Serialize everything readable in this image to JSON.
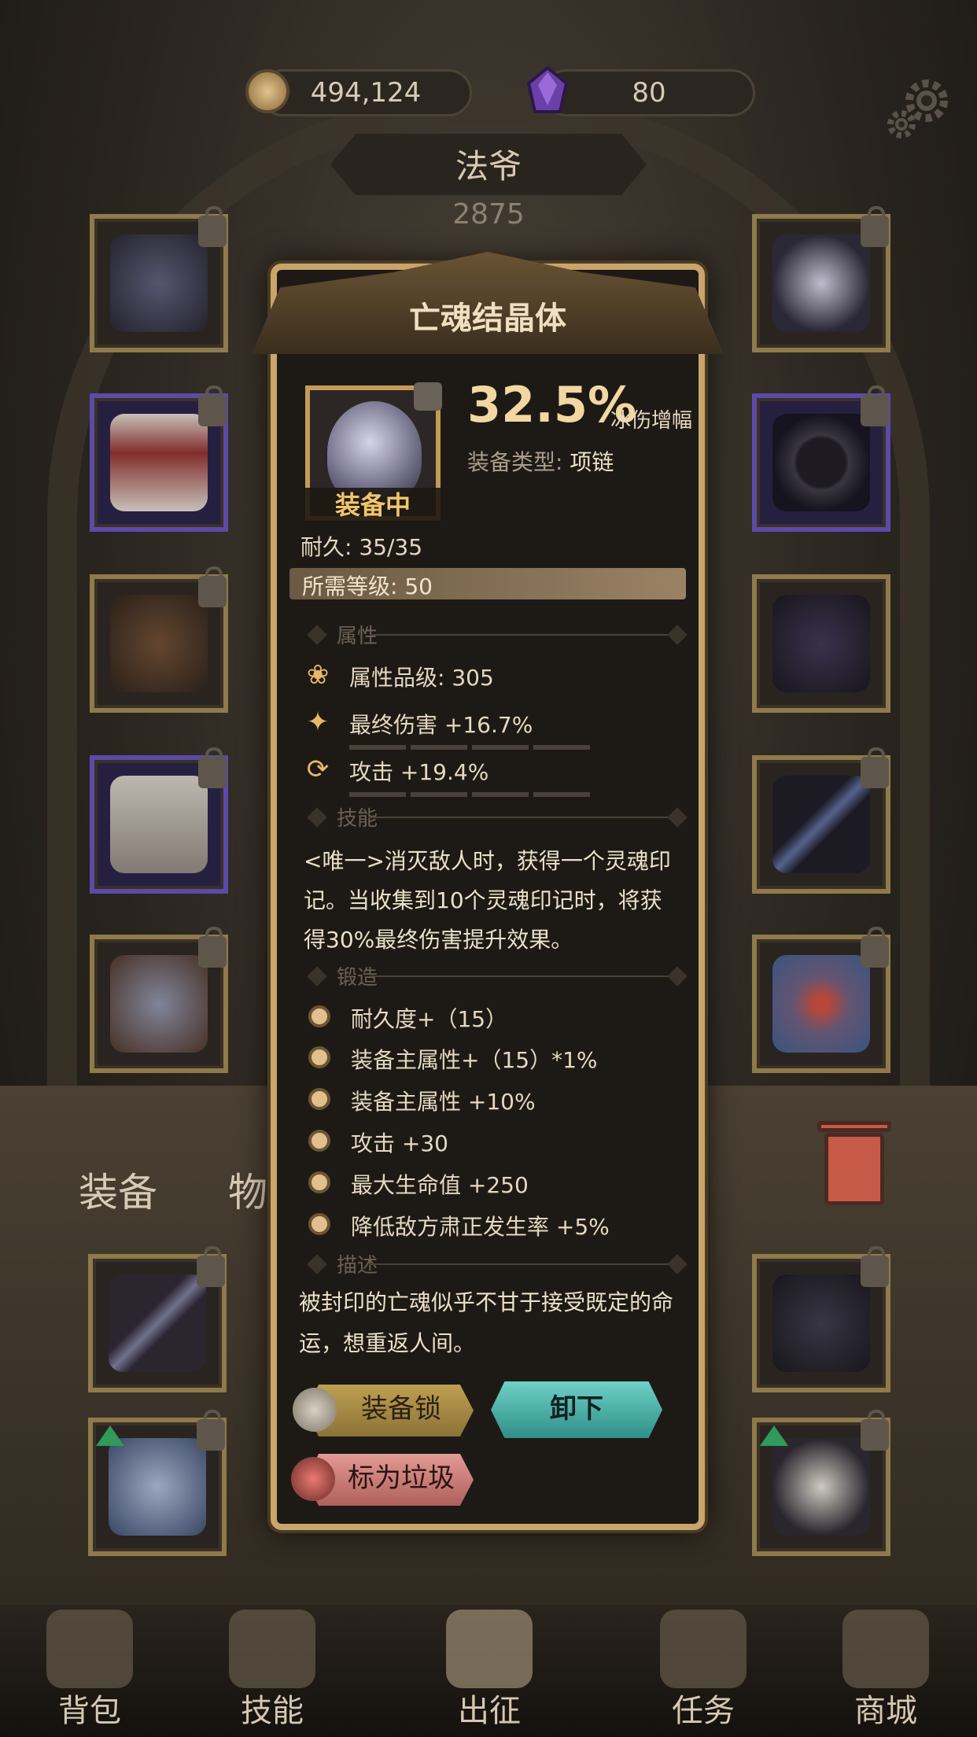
{
  "top": {
    "coins": "494,124",
    "gems": "80"
  },
  "character": {
    "name": "法爷",
    "power": "2875"
  },
  "tooltip": {
    "title": "亡魂结晶体",
    "equipped_label": "装备中",
    "main_stat_value": "32.5%",
    "main_stat_name": "冰伤增幅",
    "type_label": "装备类型:",
    "type_value": "项链",
    "durability": "耐久: 35/35",
    "required_level": "所需等级: 50",
    "section_attributes": "属性",
    "attr_grade": "属性品级: 305",
    "attributes": [
      {
        "text": "最终伤害 +16.7%",
        "icon": "sparkle-icon",
        "filled_segments": 0
      },
      {
        "text": "攻击 +19.4%",
        "icon": "cycle-icon",
        "filled_segments": 0
      }
    ],
    "section_skill": "技能",
    "skill_text": "<唯一>消灭敌人时，获得一个灵魂印记。当收集到10个灵魂印记时，将获得30%最终伤害提升效果。",
    "section_forge": "锻造",
    "forge": [
      "耐久度+（15）",
      "装备主属性+（15）*1%",
      "装备主属性 +10%",
      "攻击 +30",
      "最大生命值 +250",
      "降低敌方肃正发生率 +5%"
    ],
    "section_desc": "描述",
    "description": "被封印的亡魂似乎不甘于接受既定的命运，想重返人间。",
    "buttons": {
      "lock": "装备锁",
      "unequip": "卸下",
      "mark_trash": "标为垃圾"
    }
  },
  "bag_tabs": [
    "装备",
    "物品"
  ],
  "bottom_nav": [
    "背包",
    "技能",
    "出征",
    "任务",
    "商城"
  ],
  "colors": {
    "gold": "#c9a56b",
    "accent_teal": "#2f8f88",
    "trash_red": "#c85a4a"
  }
}
